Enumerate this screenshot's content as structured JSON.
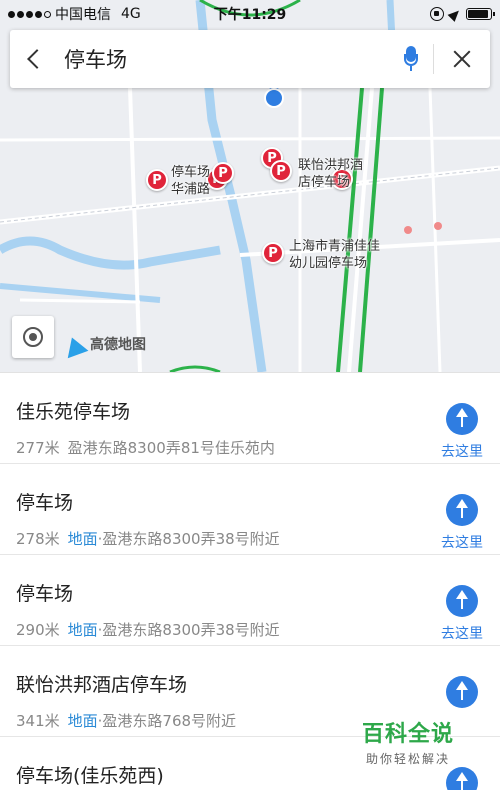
{
  "status_bar": {
    "carrier": "中国电信",
    "network": "4G",
    "time": "下午11:29"
  },
  "search": {
    "query": "停车场"
  },
  "map": {
    "labels": {
      "pin_a": "停车场",
      "pin_a_sub": "华浦路",
      "hotel": "联怡洪邦酒",
      "hotel_sub": "店停车场",
      "kindergarten": "上海市青浦佳佳",
      "kindergarten_sub": "幼儿园停车场",
      "map_logo": "高德地图"
    },
    "pin_letter": "P",
    "colors": {
      "pin": "#e0243a",
      "rail": "#2cb24a",
      "river": "#a9d2f2",
      "accent": "#2f7de1"
    }
  },
  "results": [
    {
      "title": "佳乐苑停车场",
      "distance": "277米",
      "tag": "",
      "address": "盈港东路8300弄81号佳乐苑内",
      "action": "去这里"
    },
    {
      "title": "停车场",
      "distance": "278米",
      "tag": "地面",
      "address": "·盈港东路8300弄38号附近",
      "action": "去这里"
    },
    {
      "title": "停车场",
      "distance": "290米",
      "tag": "地面",
      "address": "·盈港东路8300弄38号附近",
      "action": "去这里"
    },
    {
      "title": "联怡洪邦酒店停车场",
      "distance": "341米",
      "tag": "地面",
      "address": "·盈港东路768号附近",
      "action": ""
    },
    {
      "title": "停车场(佳乐苑西)",
      "distance": "",
      "tag": "",
      "address": "",
      "action": ""
    }
  ],
  "watermark": {
    "main": "百科全说",
    "sub": "助你轻松解决"
  }
}
